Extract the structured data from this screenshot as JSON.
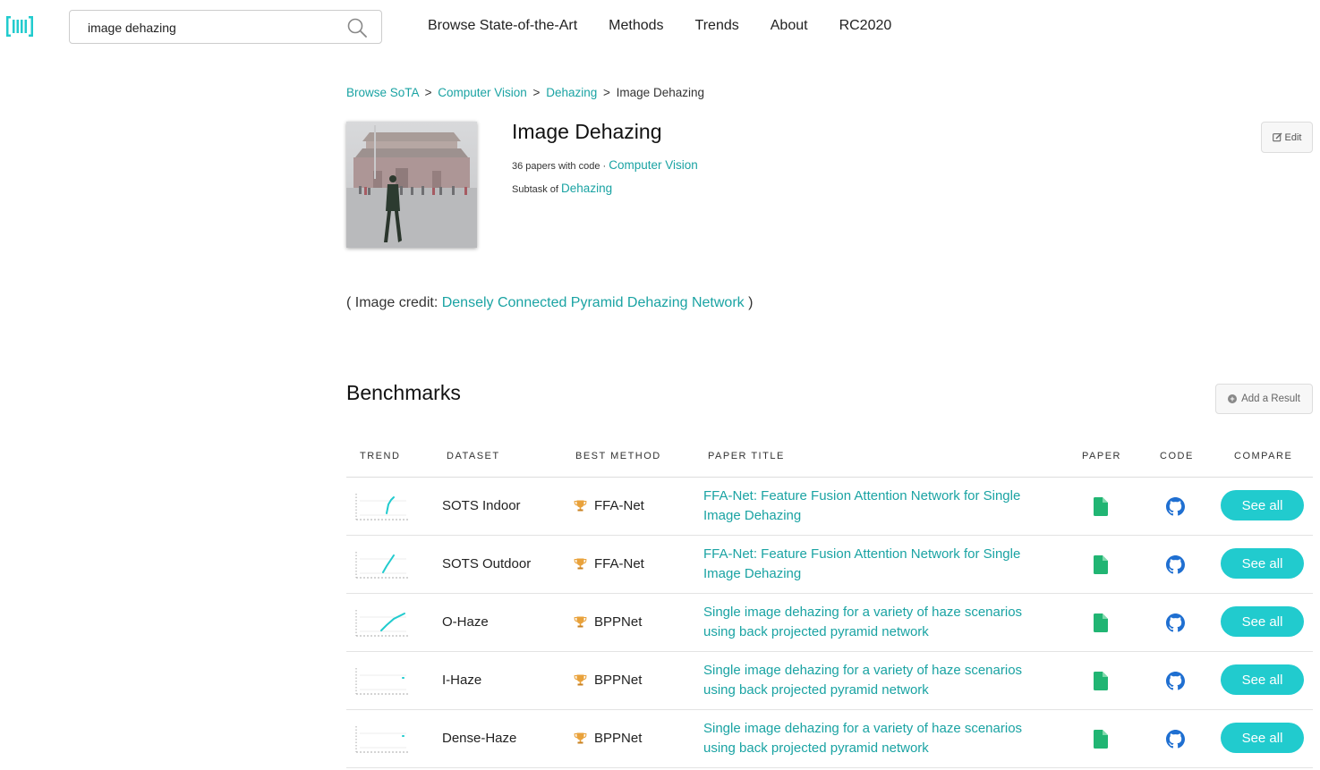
{
  "search": {
    "value": "image dehazing"
  },
  "nav": [
    "Browse State-of-the-Art",
    "Methods",
    "Trends",
    "About",
    "RC2020"
  ],
  "breadcrumb": {
    "items": [
      "Browse SoTA",
      "Computer Vision",
      "Dehazing"
    ],
    "separator": ">",
    "current": "Image Dehazing"
  },
  "task": {
    "title": "Image Dehazing",
    "papers_count": "36 papers with code",
    "dot": "·",
    "area": "Computer Vision",
    "subtask_prefix": "Subtask of",
    "parent": "Dehazing",
    "edit_label": "Edit"
  },
  "image_credit": {
    "prefix": "( Image credit:",
    "link": "Densely Connected Pyramid Dehazing Network",
    "suffix": ")"
  },
  "benchmarks": {
    "title": "Benchmarks",
    "add_label": "Add a Result",
    "headers": [
      "TREND",
      "DATASET",
      "BEST METHOD",
      "PAPER TITLE",
      "PAPER",
      "CODE",
      "COMPARE"
    ],
    "rows": [
      {
        "trend": "steep",
        "dataset": "SOTS Indoor",
        "method": "FFA-Net",
        "paper_title": "FFA-Net: Feature Fusion Attention Network for Single Image Dehazing",
        "see_all": "See all"
      },
      {
        "trend": "rise",
        "dataset": "SOTS Outdoor",
        "method": "FFA-Net",
        "paper_title": "FFA-Net: Feature Fusion Attention Network for Single Image Dehazing",
        "see_all": "See all"
      },
      {
        "trend": "gradual",
        "dataset": "O-Haze",
        "method": "BPPNet",
        "paper_title": "Single image dehazing for a variety of haze scenarios using back projected pyramid network",
        "see_all": "See all"
      },
      {
        "trend": "point",
        "dataset": "I-Haze",
        "method": "BPPNet",
        "paper_title": "Single image dehazing for a variety of haze scenarios using back projected pyramid network",
        "see_all": "See all"
      },
      {
        "trend": "point",
        "dataset": "Dense-Haze",
        "method": "BPPNet",
        "paper_title": "Single image dehazing for a variety of haze scenarios using back projected pyramid network",
        "see_all": "See all"
      }
    ]
  },
  "colors": {
    "accent": "#1aa3a3",
    "button": "#21cbce",
    "paper_icon": "#21b573",
    "code_icon": "#1f6fd1",
    "trophy": "#e9a23b"
  }
}
